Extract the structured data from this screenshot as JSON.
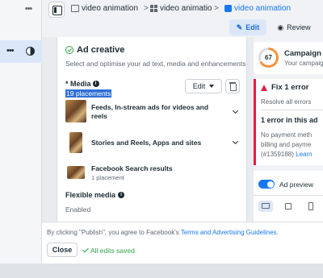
{
  "breadcrumb": [
    {
      "label": "video animation",
      "icon": "folder-icon"
    },
    {
      "label": "video animatio",
      "icon": "grid-icon"
    },
    {
      "label": "video animation",
      "icon": "ad-icon",
      "active": true
    }
  ],
  "separator": ">",
  "mode_tabs": {
    "edit": "Edit",
    "review": "Review"
  },
  "rail": {
    "dots": "•••"
  },
  "ad_creative": {
    "title": "Ad creative",
    "subtitle": "Select and optimise your ad text, media and enhancements.",
    "media_label": "* Media",
    "info_glyph": "i",
    "placements_count": "19 placements",
    "edit_dropdown": "Edit",
    "placements": [
      {
        "title_line1": "Feeds, In-stream ads for videos and",
        "title_line2": "reels"
      },
      {
        "title_line1": "Stories and Reels, Apps and sites",
        "title_line2": ""
      },
      {
        "title_line1": "Facebook Search results",
        "subtitle": "1 placement"
      }
    ],
    "flexible_media_label": "Flexible media",
    "flexible_media_value": "Enabled"
  },
  "campaign": {
    "score": "67",
    "title": "Campaign",
    "subtitle": "Your campaign"
  },
  "errors": {
    "title": "Fix 1 error",
    "resolve": "Resolve all errors",
    "section": "1 error in this ad",
    "body_line1": "No payment meth",
    "body_line2": "billing and payme",
    "body_line3": "(#1359188)",
    "learn": "Learn"
  },
  "preview": {
    "label": "Ad preview",
    "enabled": true
  },
  "footer": {
    "legal_prefix": "By clicking \"Publish\", you agree to Facebook's ",
    "legal_link": "Terms and Advertising Guidelines",
    "legal_suffix": ".",
    "close": "Close",
    "saved": "All edits saved"
  },
  "colors": {
    "accent": "#1877f2",
    "error": "#e41e3f",
    "success": "#31a24c",
    "score": "#f7913d"
  }
}
